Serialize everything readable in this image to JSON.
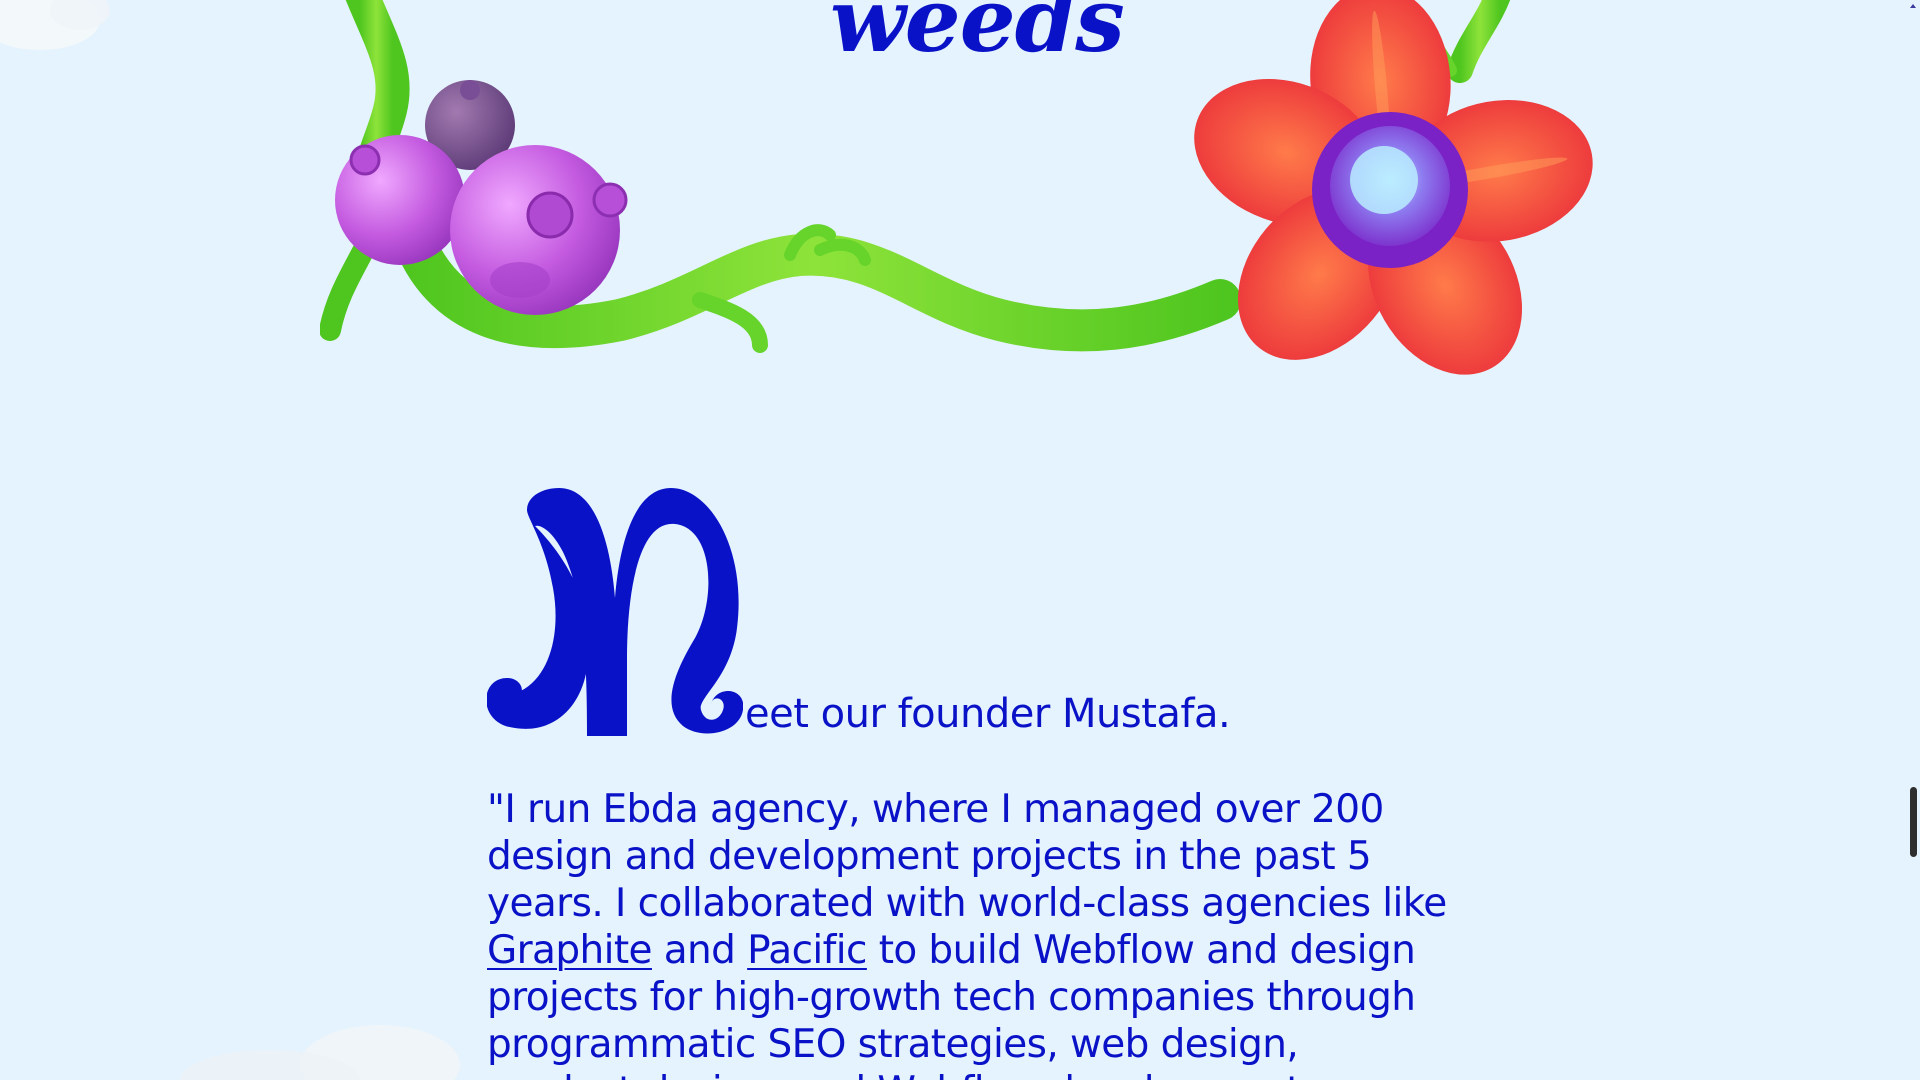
{
  "hero": {
    "title": "weeds"
  },
  "founder": {
    "dropcap_letter": "M",
    "heading_rest": "eet our founder Mustafa."
  },
  "quote": {
    "part1": "\"I run Ebda agency, where I managed over 200 design and development projects in the past 5 years. I collaborated with world-class agencies like ",
    "link1": "Graphite",
    "part2": " and ",
    "link2": "Pacific",
    "part3": " to build Webflow and design projects for high-growth tech companies through programmatic SEO strategies, web design, product design, and Webflow development."
  },
  "colors": {
    "background": "#e4f3fd",
    "brand_blue": "#0a12c8",
    "vine_green": "#5cd12a",
    "flower_red": "#f0453a",
    "berry_purple": "#c45be0"
  },
  "icons": {
    "vine": "vine-illustration",
    "flower": "red-flower-illustration",
    "berries": "purple-berries-illustration"
  }
}
